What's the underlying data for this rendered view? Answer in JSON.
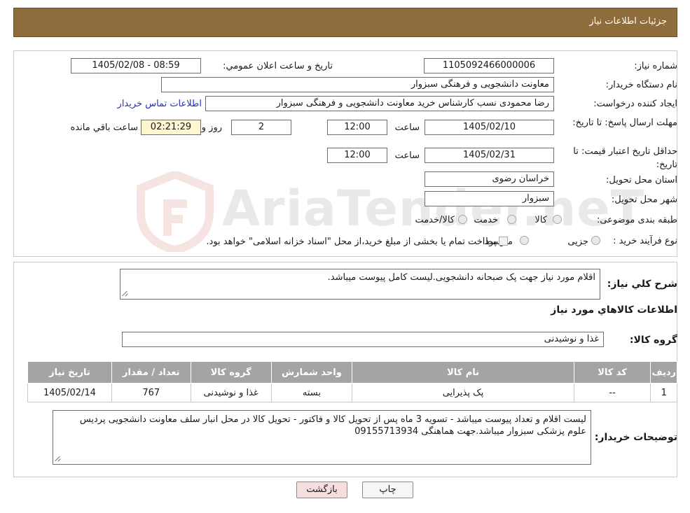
{
  "header": {
    "title": "جزئیات اطلاعات نیاز"
  },
  "watermark": {
    "text": "AriaTender.neT"
  },
  "form": {
    "need_number": {
      "label": "شماره نیاز:",
      "value": "1105092466000006"
    },
    "announce_datetime": {
      "label": "تاریخ و ساعت اعلان عمومي:",
      "value": "1405/02/08 - 08:59"
    },
    "buyer_org": {
      "label": "نام دستگاه خریدار:",
      "value": "معاونت دانشجویی و فرهنگی سبزوار"
    },
    "requester": {
      "label": "ایجاد کننده درخواست:",
      "value": "رضا محمودی نسب کارشناس خرید معاونت دانشجویی و فرهنگی سبزوار"
    },
    "contact_link": "اطلاعات تماس خریدار",
    "reply_deadline": {
      "label": "مهلت ارسال پاسخ: تا تاریخ:",
      "date": "1405/02/10",
      "time_label": "ساعت",
      "time": "12:00",
      "days": "2",
      "days_label": "روز و",
      "remaining": "02:21:29",
      "remaining_label": "ساعت باقي مانده"
    },
    "price_validity": {
      "label": "حداقل تاریخ اعتبار قیمت: تا تاریخ:",
      "date": "1405/02/31",
      "time_label": "ساعت",
      "time": "12:00"
    },
    "delivery_province": {
      "label": "استان محل تحویل:",
      "value": "خراسان رضوی"
    },
    "delivery_city": {
      "label": "شهر محل تحویل:",
      "value": "سبزوار"
    },
    "category": {
      "label": "طبقه بندی موضوعی:",
      "options": [
        "کالا",
        "خدمت",
        "کالا/خدمت"
      ]
    },
    "purchase_type": {
      "label": "نوع فرآیند خرید :",
      "options": [
        "جزیی",
        "متوسط"
      ],
      "note": "پرداخت تمام یا بخشی از مبلغ خرید،از محل \"اسناد خزانه اسلامی\" خواهد بود."
    }
  },
  "details": {
    "summary_label": "شرح كلي نياز:",
    "summary": "اقلام مورد نیاز جهت پک صبحانه دانشجویی.لیست کامل پیوست میباشد.",
    "items_title": "اطلاعات كالاهاي مورد نياز",
    "goods_group_label": "گروه کالا:",
    "goods_group": "غذا و نوشیدنی",
    "table": {
      "headers": [
        "رديف",
        "کد کالا",
        "نام کالا",
        "واحد شمارش",
        "گروه کالا",
        "تعداد / مقدار",
        "تاریخ نیاز"
      ],
      "rows": [
        [
          "1",
          "--",
          "پک پذیرایی",
          "بسته",
          "غذا و نوشیدنی",
          "767",
          "1405/02/14"
        ]
      ]
    },
    "buyer_notes_label": "توضیحات خریدار:",
    "buyer_notes": "لیست اقلام و تعداد پیوست میباشد - تسویه 3 ماه پس از تحویل کالا و فاکتور - تحویل کالا در محل انبار سلف معاونت دانشجویی پردیس علوم پزشکی سبزوار میباشد.جهت هماهنگی 09155713934"
  },
  "buttons": {
    "print": "چاپ",
    "back": "بازگشت"
  },
  "colors": {
    "header_bg": "#8f6c3b",
    "table_header_bg": "#a4a4a4",
    "back_button_bg": "#f7dede",
    "link": "#2233bb"
  }
}
